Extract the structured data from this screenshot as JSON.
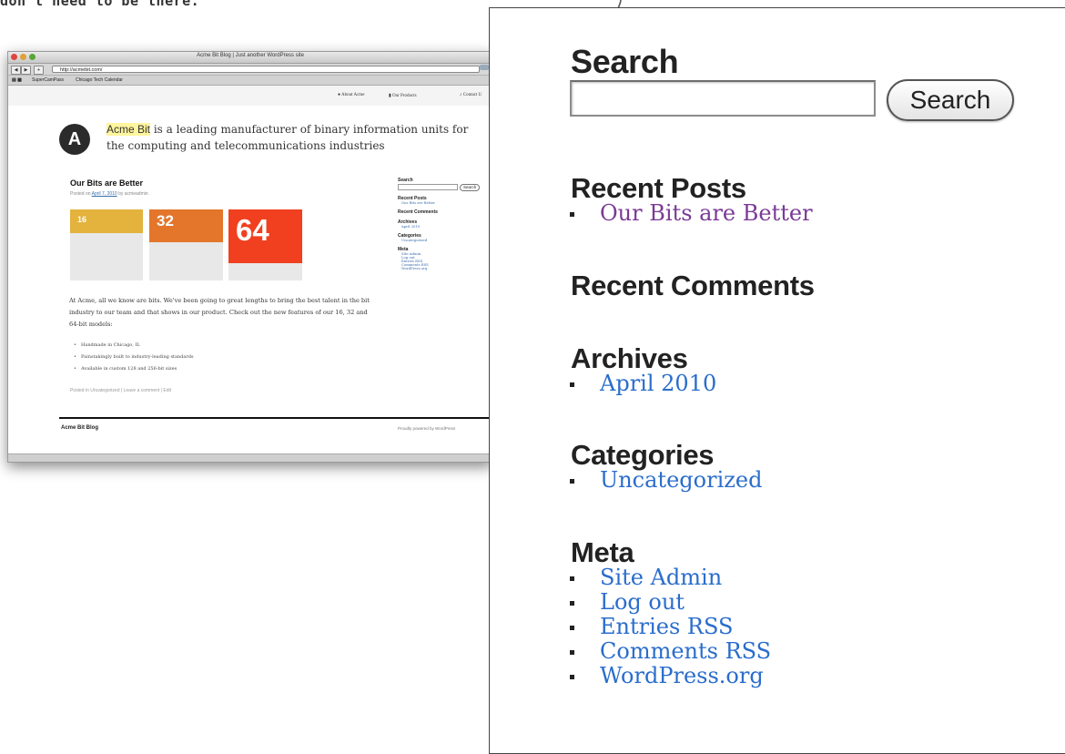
{
  "note": "don't need to be there.",
  "browser": {
    "title": "Acme Bit Blog | Just another WordPress site",
    "url": "http://acmebit.com/",
    "back_label": "◀",
    "forward_label": "▶",
    "add_label": "+",
    "bookmarks": [
      "SuperCamPass",
      "Chicago Tech Calendar"
    ],
    "nav_links": [
      "About Acme",
      "Our Products",
      "Contact U"
    ],
    "logo_letter": "A",
    "tagline_brand": "Acme Bit",
    "tagline_rest": " is a leading manufacturer of binary information units for the computing and telecommunications industries",
    "post": {
      "title": "Our Bits are Better",
      "meta_prefix": "Posted on ",
      "meta_date": "April 7, 2010",
      "meta_suffix": " by acmeadmin",
      "tiles": [
        {
          "label": "16",
          "color": "#e3b33e"
        },
        {
          "label": "32",
          "color": "#e3762b"
        },
        {
          "label": "64",
          "color": "#f0401f"
        }
      ],
      "body": "At Acme, all we know are bits. We've been going to great lengths to bring the best talent in the bit industry to our team and that shows in our product. Check out the new features of our 16, 32 and 64-bit models:",
      "bullets": [
        "Handmade in Chicago, IL",
        "Painstakingly built to industry-leading standards",
        "Available in custom 128 and 256-bit sizes"
      ],
      "filed": "Posted in Uncategorized | Leave a comment | Edit"
    },
    "mini_sidebar": {
      "search": "Search",
      "search_button": "Search",
      "recent_posts": "Recent Posts",
      "recent_posts_items": [
        "Our Bits are Better"
      ],
      "recent_comments": "Recent Comments",
      "archives": "Archives",
      "archives_items": [
        "April 2010"
      ],
      "categories": "Categories",
      "categories_items": [
        "Uncategorized"
      ],
      "meta": "Meta",
      "meta_items": [
        "Site Admin",
        "Log out",
        "Entries RSS",
        "Comments RSS",
        "WordPress.org"
      ]
    },
    "footer_left": "Acme Bit Blog",
    "footer_right": "Proudly powered by WordPress"
  },
  "zoom": {
    "search_heading": "Search",
    "search_input_value": "",
    "search_button": "Search",
    "recent_posts_heading": "Recent Posts",
    "recent_posts": [
      "Our Bits are Better"
    ],
    "recent_comments_heading": "Recent Comments",
    "archives_heading": "Archives",
    "archives": [
      "April 2010"
    ],
    "categories_heading": "Categories",
    "categories": [
      "Uncategorized"
    ],
    "meta_heading": "Meta",
    "meta": [
      "Site Admin",
      "Log out",
      "Entries RSS",
      "Comments RSS",
      "WordPress.org"
    ]
  },
  "colors": {
    "link": "#2a6dcc",
    "visited": "#7b3a96",
    "highlight": "#fff59d"
  }
}
